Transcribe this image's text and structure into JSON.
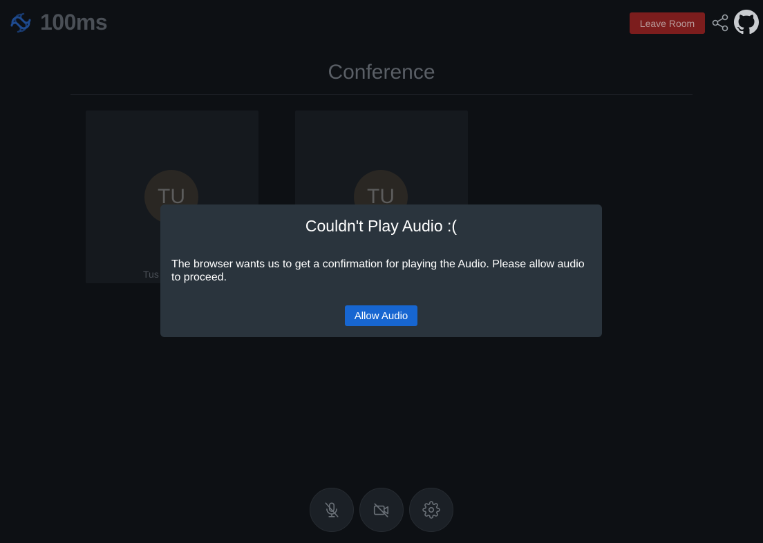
{
  "header": {
    "logo_text": "100ms",
    "leave_label": "Leave Room",
    "share_icon": "share-icon",
    "github_icon": "github-icon"
  },
  "conference": {
    "title": "Conference",
    "tiles": [
      {
        "initials": "TU",
        "name": "Tus"
      },
      {
        "initials": "TU",
        "name": ""
      }
    ]
  },
  "modal": {
    "title": "Couldn't Play Audio :(",
    "body": "The browser wants us to get a confirmation for playing the Audio. Please allow audio to proceed.",
    "button_label": "Allow Audio"
  },
  "controls": {
    "items": [
      "mic-off-icon",
      "camera-off-icon",
      "settings-gear-icon"
    ]
  },
  "colors": {
    "background": "#0d1014",
    "leave_button": "#7c1d1d",
    "modal": "#2a343d",
    "primary_button": "#1766d1"
  }
}
